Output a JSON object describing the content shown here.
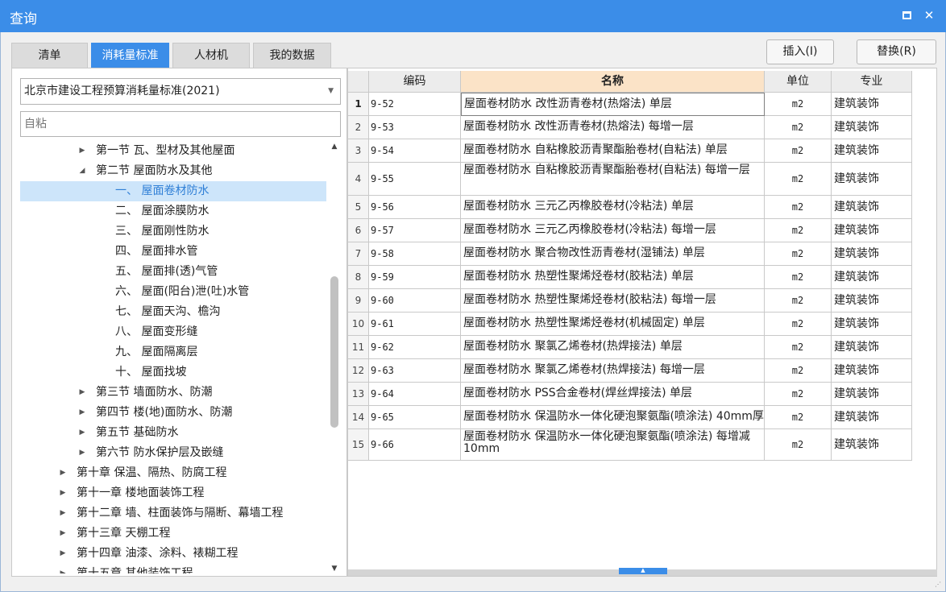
{
  "window": {
    "title": "查询"
  },
  "tabs": [
    {
      "label": "清单",
      "active": false
    },
    {
      "label": "消耗量标准",
      "active": true
    },
    {
      "label": "人材机",
      "active": false
    },
    {
      "label": "我的数据",
      "active": false
    }
  ],
  "buttons": {
    "insert": "插入(I)",
    "replace": "替换(R)"
  },
  "left": {
    "standard_select": "北京市建设工程预算消耗量标准(2021)",
    "search_value": "自粘",
    "tree": [
      {
        "level": 2,
        "expanded": false,
        "label": "第一节 瓦、型材及其他屋面"
      },
      {
        "level": 2,
        "expanded": true,
        "label": "第二节 屋面防水及其他"
      },
      {
        "level": 3,
        "label": "一、 屋面卷材防水",
        "selected": true
      },
      {
        "level": 3,
        "label": "二、 屋面涂膜防水"
      },
      {
        "level": 3,
        "label": "三、 屋面刚性防水"
      },
      {
        "level": 3,
        "label": "四、 屋面排水管"
      },
      {
        "level": 3,
        "label": "五、 屋面排(透)气管"
      },
      {
        "level": 3,
        "label": "六、 屋面(阳台)泄(吐)水管"
      },
      {
        "level": 3,
        "label": "七、 屋面天沟、檐沟"
      },
      {
        "level": 3,
        "label": "八、 屋面变形缝"
      },
      {
        "level": 3,
        "label": "九、 屋面隔离层"
      },
      {
        "level": 3,
        "label": "十、 屋面找坡"
      },
      {
        "level": 2,
        "expanded": false,
        "label": "第三节 墙面防水、防潮"
      },
      {
        "level": 2,
        "expanded": false,
        "label": "第四节 楼(地)面防水、防潮"
      },
      {
        "level": 2,
        "expanded": false,
        "label": "第五节 基础防水"
      },
      {
        "level": 2,
        "expanded": false,
        "label": "第六节 防水保护层及嵌缝"
      },
      {
        "level": 1,
        "expanded": false,
        "label": "第十章 保温、隔热、防腐工程"
      },
      {
        "level": 1,
        "expanded": false,
        "label": "第十一章 楼地面装饰工程"
      },
      {
        "level": 1,
        "expanded": false,
        "label": "第十二章 墙、柱面装饰与隔断、幕墙工程"
      },
      {
        "level": 1,
        "expanded": false,
        "label": "第十三章 天棚工程"
      },
      {
        "level": 1,
        "expanded": false,
        "label": "第十四章 油漆、涂料、裱糊工程"
      },
      {
        "level": 1,
        "expanded": false,
        "label": "第十五章 其他装饰工程"
      }
    ]
  },
  "grid": {
    "headers": {
      "code": "编码",
      "name": "名称",
      "unit": "单位",
      "major": "专业"
    },
    "rows": [
      {
        "num": "1",
        "code": "9-52",
        "name": "屋面卷材防水 改性沥青卷材(热熔法) 单层",
        "unit": "m2",
        "major": "建筑装饰"
      },
      {
        "num": "2",
        "code": "9-53",
        "name": "屋面卷材防水 改性沥青卷材(热熔法) 每增一层",
        "unit": "m2",
        "major": "建筑装饰"
      },
      {
        "num": "3",
        "code": "9-54",
        "name": "屋面卷材防水 自粘橡胶沥青聚酯胎卷材(自粘法) 单层",
        "unit": "m2",
        "major": "建筑装饰"
      },
      {
        "num": "4",
        "code": "9-55",
        "name": "屋面卷材防水 自粘橡胶沥青聚酯胎卷材(自粘法) 每增一层",
        "unit": "m2",
        "major": "建筑装饰"
      },
      {
        "num": "5",
        "code": "9-56",
        "name": "屋面卷材防水 三元乙丙橡胶卷材(冷粘法) 单层",
        "unit": "m2",
        "major": "建筑装饰"
      },
      {
        "num": "6",
        "code": "9-57",
        "name": "屋面卷材防水 三元乙丙橡胶卷材(冷粘法) 每增一层",
        "unit": "m2",
        "major": "建筑装饰"
      },
      {
        "num": "7",
        "code": "9-58",
        "name": "屋面卷材防水 聚合物改性沥青卷材(湿铺法) 单层",
        "unit": "m2",
        "major": "建筑装饰"
      },
      {
        "num": "8",
        "code": "9-59",
        "name": "屋面卷材防水 热塑性聚烯烃卷材(胶粘法) 单层",
        "unit": "m2",
        "major": "建筑装饰"
      },
      {
        "num": "9",
        "code": "9-60",
        "name": "屋面卷材防水 热塑性聚烯烃卷材(胶粘法) 每增一层",
        "unit": "m2",
        "major": "建筑装饰"
      },
      {
        "num": "10",
        "code": "9-61",
        "name": "屋面卷材防水 热塑性聚烯烃卷材(机械固定) 单层",
        "unit": "m2",
        "major": "建筑装饰"
      },
      {
        "num": "11",
        "code": "9-62",
        "name": "屋面卷材防水 聚氯乙烯卷材(热焊接法) 单层",
        "unit": "m2",
        "major": "建筑装饰"
      },
      {
        "num": "12",
        "code": "9-63",
        "name": "屋面卷材防水 聚氯乙烯卷材(热焊接法) 每增一层",
        "unit": "m2",
        "major": "建筑装饰"
      },
      {
        "num": "13",
        "code": "9-64",
        "name": "屋面卷材防水 PSS合金卷材(焊丝焊接法) 单层",
        "unit": "m2",
        "major": "建筑装饰"
      },
      {
        "num": "14",
        "code": "9-65",
        "name": "屋面卷材防水 保温防水一体化硬泡聚氨酯(喷涂法) 40mm厚",
        "unit": "m2",
        "major": "建筑装饰"
      },
      {
        "num": "15",
        "code": "9-66",
        "name": "屋面卷材防水 保温防水一体化硬泡聚氨酯(喷涂法) 每增减10mm",
        "unit": "m2",
        "major": "建筑装饰"
      }
    ]
  }
}
